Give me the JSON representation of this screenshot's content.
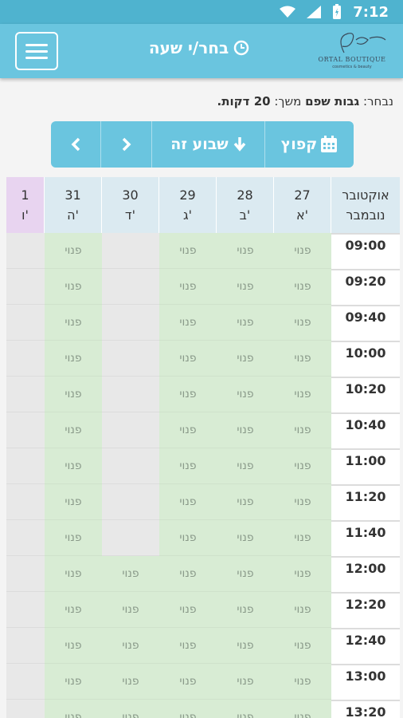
{
  "status_bar": {
    "time": "7:12"
  },
  "header": {
    "title": "בחר/י שעה",
    "logo_text": "ORTAL BOUTIQUE",
    "logo_sub": "cosmetics & beauty"
  },
  "selection": {
    "prefix": "נבחר:",
    "service": "גבות שפם",
    "duration_label": "משך:",
    "duration": "20 דקות."
  },
  "nav": {
    "jump_label": "קפוץ",
    "this_week_label": "שבוע זה"
  },
  "calendar": {
    "month_labels": [
      "אוקטובר",
      "נובמבר"
    ],
    "days": [
      {
        "num": "27",
        "name": "א'"
      },
      {
        "num": "28",
        "name": "ב'"
      },
      {
        "num": "29",
        "name": "ג'"
      },
      {
        "num": "30",
        "name": "ד'"
      },
      {
        "num": "31",
        "name": "ה'"
      },
      {
        "num": "1",
        "name": "ו'"
      }
    ],
    "free_label": "פנוי",
    "times": [
      "09:00",
      "09:20",
      "09:40",
      "10:00",
      "10:20",
      "10:40",
      "11:00",
      "11:20",
      "11:40",
      "12:00",
      "12:20",
      "12:40",
      "13:00",
      "13:20"
    ],
    "availability": {
      "27": [
        "free",
        "free",
        "free",
        "free",
        "free",
        "free",
        "free",
        "free",
        "free",
        "free",
        "free",
        "free",
        "free",
        "free"
      ],
      "28": [
        "free",
        "free",
        "free",
        "free",
        "free",
        "free",
        "free",
        "free",
        "free",
        "free",
        "free",
        "free",
        "free",
        "free"
      ],
      "29": [
        "free",
        "free",
        "free",
        "free",
        "free",
        "free",
        "free",
        "free",
        "free",
        "free",
        "free",
        "free",
        "free",
        "free"
      ],
      "30": [
        "busy",
        "busy",
        "busy",
        "busy",
        "busy",
        "busy",
        "busy",
        "busy",
        "busy",
        "free",
        "free",
        "free",
        "free",
        "free"
      ],
      "31": [
        "free",
        "free",
        "free",
        "free",
        "free",
        "free",
        "free",
        "free",
        "free",
        "free",
        "free",
        "free",
        "free",
        "free"
      ],
      "1": [
        "busy",
        "busy",
        "busy",
        "busy",
        "busy",
        "busy",
        "busy",
        "busy",
        "busy",
        "busy",
        "busy",
        "busy",
        "busy",
        "busy"
      ]
    }
  },
  "colors": {
    "accent": "#6ac5df",
    "free": "#d8ecd4",
    "busy": "#e8e8e8",
    "friday_header": "#e8d4f0"
  }
}
